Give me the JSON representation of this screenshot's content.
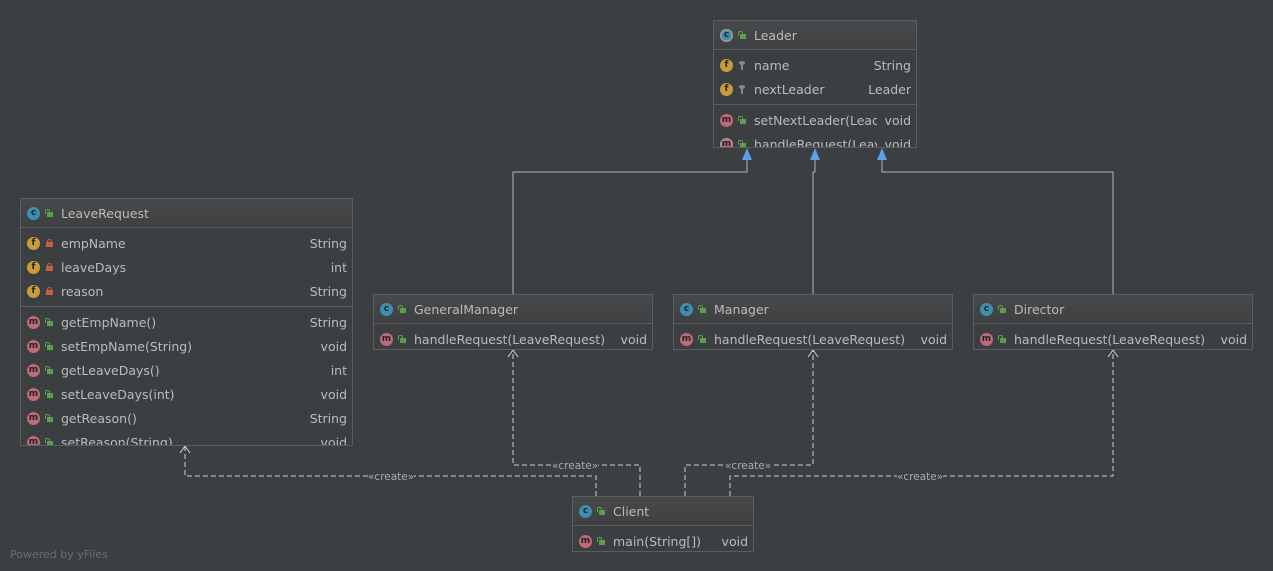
{
  "classes": {
    "leader": {
      "name": "Leader",
      "abstract": true,
      "fields": [
        {
          "name": "name",
          "type": "String",
          "vis": "pkg"
        },
        {
          "name": "nextLeader",
          "type": "Leader",
          "vis": "pkg"
        }
      ],
      "methods": [
        {
          "name": "setNextLeader(Leader)",
          "type": "void",
          "vis": "pub"
        },
        {
          "name": "handleRequest(LeaveRequest)",
          "type": "void",
          "vis": "pub",
          "abstract": true
        }
      ]
    },
    "leaveRequest": {
      "name": "LeaveRequest",
      "fields": [
        {
          "name": "empName",
          "type": "String",
          "vis": "priv"
        },
        {
          "name": "leaveDays",
          "type": "int",
          "vis": "priv"
        },
        {
          "name": "reason",
          "type": "String",
          "vis": "priv"
        }
      ],
      "methods": [
        {
          "name": "getEmpName()",
          "type": "String",
          "vis": "pub"
        },
        {
          "name": "setEmpName(String)",
          "type": "void",
          "vis": "pub"
        },
        {
          "name": "getLeaveDays()",
          "type": "int",
          "vis": "pub"
        },
        {
          "name": "setLeaveDays(int)",
          "type": "void",
          "vis": "pub"
        },
        {
          "name": "getReason()",
          "type": "String",
          "vis": "pub"
        },
        {
          "name": "setReason(String)",
          "type": "void",
          "vis": "pub"
        }
      ]
    },
    "generalManager": {
      "name": "GeneralManager",
      "fields": [],
      "methods": [
        {
          "name": "handleRequest(LeaveRequest)",
          "type": "void",
          "vis": "pub"
        }
      ]
    },
    "manager": {
      "name": "Manager",
      "fields": [],
      "methods": [
        {
          "name": "handleRequest(LeaveRequest)",
          "type": "void",
          "vis": "pub"
        }
      ]
    },
    "director": {
      "name": "Director",
      "fields": [],
      "methods": [
        {
          "name": "handleRequest(LeaveRequest)",
          "type": "void",
          "vis": "pub"
        }
      ]
    },
    "client": {
      "name": "Client",
      "fields": [],
      "methods": [
        {
          "name": "main(String[])",
          "type": "void",
          "vis": "pub"
        }
      ]
    }
  },
  "edges": {
    "create_label": "«create»"
  },
  "colors": {
    "background": "#3c3f41",
    "inheritance": "#5e9ee8",
    "dependency": "#cfcfcf"
  },
  "footer": "Powered by yFiles"
}
